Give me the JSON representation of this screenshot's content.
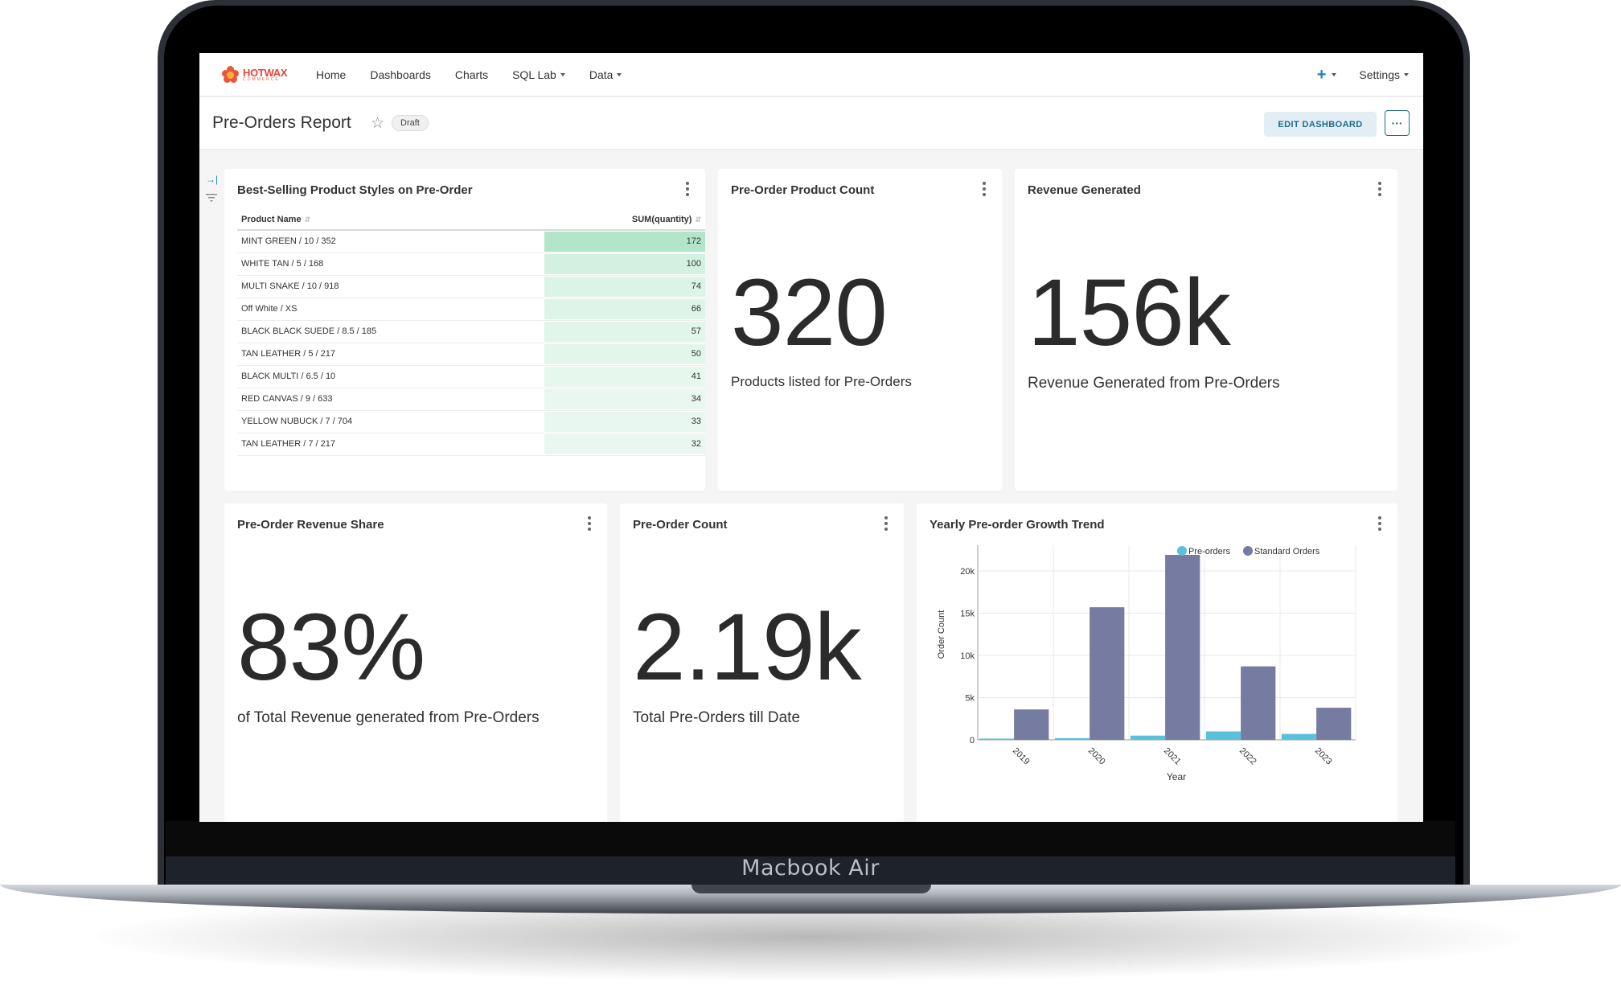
{
  "device": {
    "label": "Macbook Air"
  },
  "navbar": {
    "logo_line1": "HOTWAX",
    "logo_line2": "COMMERCE",
    "items": [
      {
        "label": "Home",
        "has_caret": false
      },
      {
        "label": "Dashboards",
        "has_caret": false
      },
      {
        "label": "Charts",
        "has_caret": false
      },
      {
        "label": "SQL Lab",
        "has_caret": true
      },
      {
        "label": "Data",
        "has_caret": true
      }
    ],
    "plus_label": "+",
    "settings_label": "Settings"
  },
  "header": {
    "title": "Pre-Orders Report",
    "status_badge": "Draft",
    "edit_button": "EDIT DASHBOARD",
    "more_button": "···"
  },
  "table_card": {
    "title": "Best-Selling Product Styles on Pre-Order",
    "columns": [
      "Product Name",
      "SUM(quantity)"
    ],
    "rows": [
      {
        "name": "MINT GREEN / 10 / 352",
        "value": 172
      },
      {
        "name": "WHITE TAN / 5 / 168",
        "value": 100
      },
      {
        "name": "MULTI SNAKE / 10 / 918",
        "value": 74
      },
      {
        "name": "Off White / XS",
        "value": 66
      },
      {
        "name": "BLACK BLACK SUEDE / 8.5 / 185",
        "value": 57
      },
      {
        "name": "TAN LEATHER / 5 / 217",
        "value": 50
      },
      {
        "name": "BLACK MULTI / 6.5 / 10",
        "value": 41
      },
      {
        "name": "RED CANVAS / 9 / 633",
        "value": 34
      },
      {
        "name": "YELLOW NUBUCK / 7 / 704",
        "value": 33
      },
      {
        "name": "TAN LEATHER / 7 / 217",
        "value": 32
      }
    ]
  },
  "product_count_card": {
    "title": "Pre-Order Product Count",
    "value": "320",
    "subheader": "Products listed for Pre-Orders"
  },
  "revenue_card": {
    "title": "Revenue Generated",
    "value": "156k",
    "subheader": "Revenue Generated from Pre-Orders"
  },
  "revenue_share_card": {
    "title": "Pre-Order Revenue Share",
    "value": "83%",
    "subheader": "of Total Revenue generated from Pre-Orders"
  },
  "order_count_card": {
    "title": "Pre-Order Count",
    "value": "2.19k",
    "subheader": "Total Pre-Orders till Date"
  },
  "trend_card": {
    "title": "Yearly Pre-order Growth Trend"
  },
  "chart_data": {
    "type": "bar",
    "title": "Yearly Pre-order Growth Trend",
    "xlabel": "Year",
    "ylabel": "Order Count",
    "categories": [
      "2019",
      "2020",
      "2021",
      "2022",
      "2023"
    ],
    "series": [
      {
        "name": "Pre-orders",
        "color": "#5ac1dd",
        "values": [
          150,
          200,
          500,
          1000,
          700
        ]
      },
      {
        "name": "Standard Orders",
        "color": "#767ba1",
        "values": [
          3600,
          15700,
          21900,
          8700,
          3800
        ]
      }
    ],
    "ylim": [
      0,
      21900
    ],
    "yticks": [
      0,
      5000,
      10000,
      15000,
      20000
    ],
    "ytick_labels": [
      "0",
      "5k",
      "10k",
      "15k",
      "20k"
    ],
    "legend_position": "top",
    "grid": true
  }
}
